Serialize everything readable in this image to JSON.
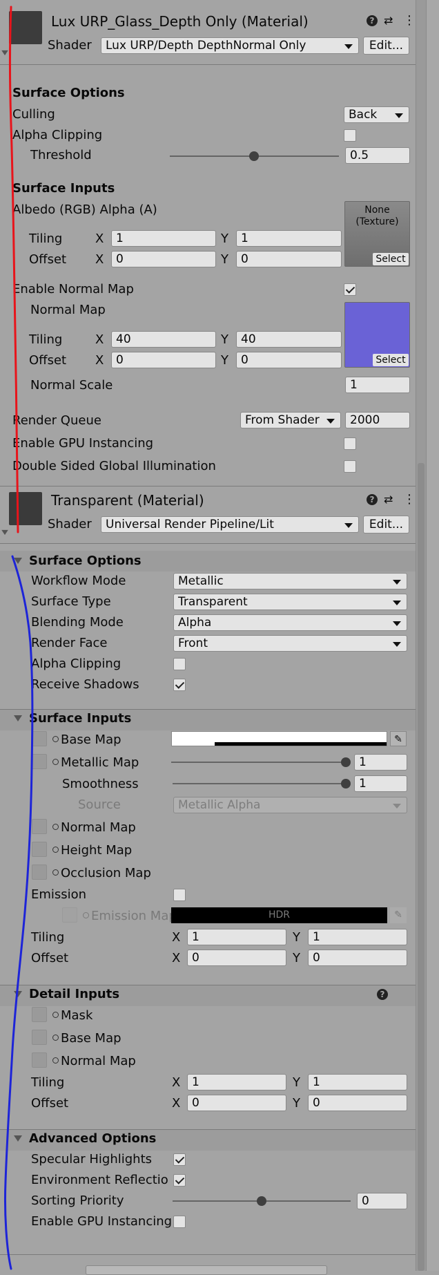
{
  "material1": {
    "title": "Lux URP_Glass_Depth Only (Material)",
    "shader_label": "Shader",
    "shader_value": "Lux URP/Depth DepthNormal Only",
    "edit_label": "Edit...",
    "surface_options": {
      "heading": "Surface Options",
      "culling_label": "Culling",
      "culling_value": "Back",
      "alpha_clipping_label": "Alpha Clipping",
      "alpha_clipping_checked": false,
      "threshold_label": "Threshold",
      "threshold_value": "0.5",
      "threshold_fraction": 0.5
    },
    "surface_inputs": {
      "heading": "Surface Inputs",
      "albedo_label": "Albedo (RGB) Alpha (A)",
      "albedo_texture": "None\n(Texture)",
      "select_label": "Select",
      "tiling_label": "Tiling",
      "offset_label": "Offset",
      "x_label": "X",
      "y_label": "Y",
      "albedo_tiling_x": "1",
      "albedo_tiling_y": "1",
      "albedo_offset_x": "0",
      "albedo_offset_y": "0",
      "enable_normal_label": "Enable Normal Map",
      "enable_normal_checked": true,
      "normal_map_label": "Normal Map",
      "normal_tiling_x": "40",
      "normal_tiling_y": "40",
      "normal_offset_x": "0",
      "normal_offset_y": "0",
      "normal_scale_label": "Normal Scale",
      "normal_scale_value": "1",
      "normal_texture_color": "#6a62d6"
    },
    "render_queue_label": "Render Queue",
    "render_queue_mode": "From Shader",
    "render_queue_value": "2000",
    "gpu_instancing_label": "Enable GPU Instancing",
    "double_sided_gi_label": "Double Sided Global Illumination"
  },
  "material2": {
    "title": "Transparent (Material)",
    "shader_label": "Shader",
    "shader_value": "Universal Render Pipeline/Lit",
    "edit_label": "Edit...",
    "surface_options": {
      "heading": "Surface Options",
      "workflow_label": "Workflow Mode",
      "workflow_value": "Metallic",
      "surface_type_label": "Surface Type",
      "surface_type_value": "Transparent",
      "blending_label": "Blending Mode",
      "blending_value": "Alpha",
      "render_face_label": "Render Face",
      "render_face_value": "Front",
      "alpha_clipping_label": "Alpha Clipping",
      "alpha_clipping_checked": false,
      "receive_shadows_label": "Receive Shadows",
      "receive_shadows_checked": true
    },
    "surface_inputs": {
      "heading": "Surface Inputs",
      "base_map_label": "Base Map",
      "metallic_map_label": "Metallic Map",
      "metallic_value": "1",
      "smoothness_label": "Smoothness",
      "smoothness_value": "1",
      "source_label": "Source",
      "source_value": "Metallic Alpha",
      "normal_map_label": "Normal Map",
      "height_map_label": "Height Map",
      "occlusion_map_label": "Occlusion Map",
      "emission_label": "Emission",
      "emission_map_label": "Emission Map",
      "hdr_label": "HDR",
      "tiling_label": "Tiling",
      "offset_label": "Offset",
      "x_label": "X",
      "y_label": "Y",
      "tiling_x": "1",
      "tiling_y": "1",
      "offset_x": "0",
      "offset_y": "0"
    },
    "detail_inputs": {
      "heading": "Detail Inputs",
      "mask_label": "Mask",
      "base_map_label": "Base Map",
      "normal_map_label": "Normal Map",
      "tiling_label": "Tiling",
      "offset_label": "Offset",
      "x_label": "X",
      "y_label": "Y",
      "tiling_x": "1",
      "tiling_y": "1",
      "offset_x": "0",
      "offset_y": "0"
    },
    "advanced_options": {
      "heading": "Advanced Options",
      "specular_label": "Specular Highlights",
      "specular_checked": true,
      "env_reflections_label": "Environment Reflections",
      "env_reflections_checked": true,
      "sorting_priority_label": "Sorting Priority",
      "sorting_priority_value": "0",
      "gpu_instancing_label": "Enable GPU Instancing",
      "gpu_instancing_checked": false
    }
  },
  "colors": {
    "background": "#a4a4a4",
    "annotation_red": "#e8141b",
    "annotation_blue": "#1d24d8"
  }
}
